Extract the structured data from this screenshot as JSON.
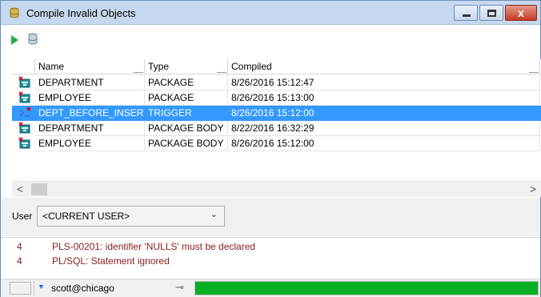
{
  "window": {
    "title": "Compile Invalid Objects",
    "close_glyph": "x"
  },
  "toolbar": {
    "run_icon": "run-icon",
    "database_icon": "database-icon"
  },
  "grid": {
    "columns": [
      "Name",
      "Type",
      "Compiled"
    ],
    "rows": [
      {
        "name": "DEPARTMENT",
        "type": "PACKAGE",
        "compiled": "8/26/2016 15:12:47",
        "icon": "package-invalid-icon",
        "selected": false
      },
      {
        "name": "EMPLOYEE",
        "type": "PACKAGE",
        "compiled": "8/26/2016 15:13:00",
        "icon": "package-invalid-icon",
        "selected": false
      },
      {
        "name": "DEPT_BEFORE_INSERT",
        "type": "TRIGGER",
        "compiled": "8/26/2016 15:12:00",
        "icon": "trigger-invalid-icon",
        "selected": true
      },
      {
        "name": "DEPARTMENT",
        "type": "PACKAGE BODY",
        "compiled": "8/22/2016 16:32:29",
        "icon": "package-body-invalid-icon",
        "selected": false
      },
      {
        "name": "EMPLOYEE",
        "type": "PACKAGE BODY",
        "compiled": "8/26/2016 15:12:00",
        "icon": "package-body-invalid-icon",
        "selected": false
      }
    ]
  },
  "scroll": {
    "left_glyph": "<",
    "right_glyph": ">"
  },
  "user_filter": {
    "label": "User",
    "value": "<CURRENT USER>",
    "chevron": "⌄"
  },
  "messages": [
    {
      "line": "4",
      "text": "PLS-00201: identifier 'NULLS' must be declared"
    },
    {
      "line": "4",
      "text": "PL/SQL: Statement ignored"
    }
  ],
  "status": {
    "connection": "scott@chicago",
    "dropdown_glyph": "▼",
    "pin_glyph": "⊸",
    "progress": 1.0
  },
  "colors": {
    "selection": "#3399ff",
    "error_text": "#8b1a1a",
    "progress": "#06b025"
  }
}
